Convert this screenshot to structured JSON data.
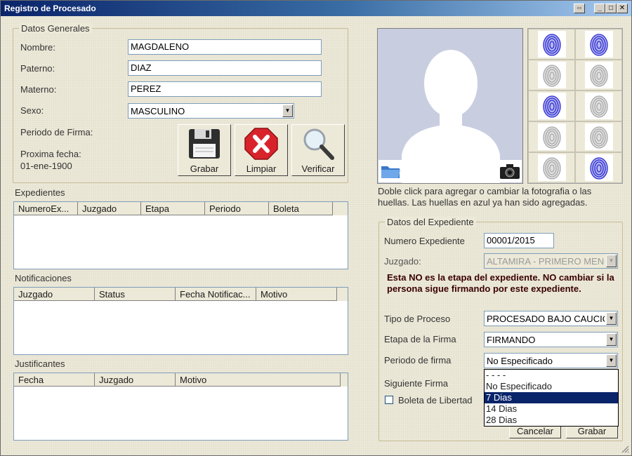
{
  "window": {
    "title": "Registro de Procesado",
    "controls": [
      "⇔",
      "_",
      "□",
      "✕"
    ]
  },
  "datos_generales": {
    "legend": "Datos Generales",
    "nombre_label": "Nombre:",
    "nombre_value": "MAGDALENO",
    "paterno_label": "Paterno:",
    "paterno_value": "DIAZ",
    "materno_label": "Materno:",
    "materno_value": "PEREZ",
    "sexo_label": "Sexo:",
    "sexo_value": "MASCULINO",
    "periodo_label": "Periodo de Firma:",
    "proxima_label": "Proxima fecha:",
    "proxima_value": "01-ene-1900",
    "grabar_label": "Grabar",
    "limpiar_label": "Limpiar",
    "verificar_label": "Verificar"
  },
  "expedientes": {
    "title": "Expedientes",
    "columns": [
      "NumeroEx...",
      "Juzgado",
      "Etapa",
      "Periodo",
      "Boleta"
    ]
  },
  "notificaciones": {
    "title": "Notificaciones",
    "columns": [
      "Juzgado",
      "Status",
      "Fecha Notificac...",
      "Motivo"
    ]
  },
  "justificantes": {
    "title": "Justificantes",
    "columns": [
      "Fecha",
      "Juzgado",
      "Motivo"
    ]
  },
  "photo": {
    "notice": "Doble click para agregar o cambiar la fotografia o las huellas. Las huellas en azul ya han sido agregadas."
  },
  "fingerprints": [
    {
      "status": "added",
      "color": "#2a2ad0"
    },
    {
      "status": "added",
      "color": "#2a2ad0"
    },
    {
      "status": "empty",
      "color": "#a8a8a8"
    },
    {
      "status": "empty",
      "color": "#a8a8a8"
    },
    {
      "status": "added",
      "color": "#2a2ad0"
    },
    {
      "status": "empty",
      "color": "#a8a8a8"
    },
    {
      "status": "empty",
      "color": "#a8a8a8"
    },
    {
      "status": "empty",
      "color": "#a8a8a8"
    },
    {
      "status": "empty",
      "color": "#a8a8a8"
    },
    {
      "status": "added",
      "color": "#2a2ad0"
    }
  ],
  "expediente": {
    "legend": "Datos del Expediente",
    "numero_label": "Numero Expediente",
    "numero_value": "00001/2015",
    "juzgado_label": "Juzgado:",
    "juzgado_value": "ALTAMIRA - PRIMERO MENOR",
    "warning": "Esta NO es la etapa del expediente. NO cambiar si la persona sigue firmando por este expediente.",
    "tipo_label": "Tipo de Proceso",
    "tipo_value": "PROCESADO BAJO CAUCION",
    "etapa_label": "Etapa de la Firma",
    "etapa_value": "FIRMANDO",
    "periodo_label": "Periodo de firma",
    "periodo_value": "No Especificado",
    "siguiente_label": "Siguiente Firma",
    "boleta_label": "Boleta de Libertad",
    "periodo_options": [
      "- - - -",
      "No Especificado",
      "7 Dias",
      "14 Dias",
      "28 Dias"
    ],
    "periodo_highlighted": "7 Dias",
    "cancelar_label": "Cancelar",
    "grabar_label": "Grabar"
  }
}
